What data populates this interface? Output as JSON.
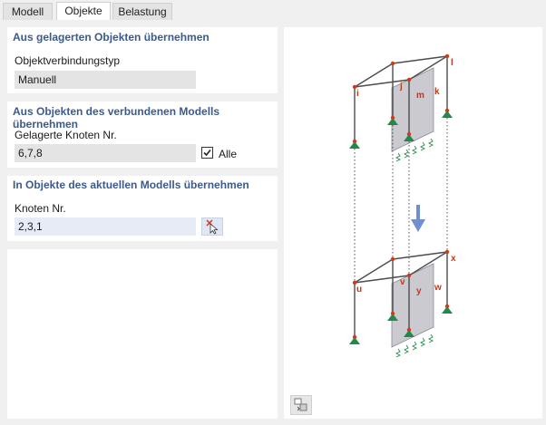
{
  "tabs": [
    {
      "label": "Modell"
    },
    {
      "label": "Objekte"
    },
    {
      "label": "Belastung"
    }
  ],
  "section_stored": {
    "title": "Aus gelagerten Objekten übernehmen",
    "type_label": "Objektverbindungstyp",
    "type_value": "Manuell"
  },
  "section_connected": {
    "title": "Aus Objekten des verbundenen Modells übernehmen",
    "nodes_label": "Gelagerte Knoten Nr.",
    "nodes_value": "6,7,8",
    "all_label": "Alle",
    "all_checked": true
  },
  "section_current": {
    "title": "In Objekte des aktuellen Modells übernehmen",
    "nodes_label": "Knoten Nr.",
    "nodes_value": "2,3,1"
  },
  "diagram": {
    "top_labels": [
      "i",
      "j",
      "k",
      "l",
      "m"
    ],
    "bottom_labels": [
      "u",
      "v",
      "w",
      "x",
      "y"
    ],
    "colors": {
      "frame": "#4d4d4d",
      "node": "#d03a1a",
      "wall": "#b8b8c0",
      "support": "#1f8a4a",
      "arrow": "#6f8fd0",
      "label": "#c0391b"
    }
  },
  "icons": {
    "pick": "pick-node-icon",
    "view": "view-options-icon"
  }
}
